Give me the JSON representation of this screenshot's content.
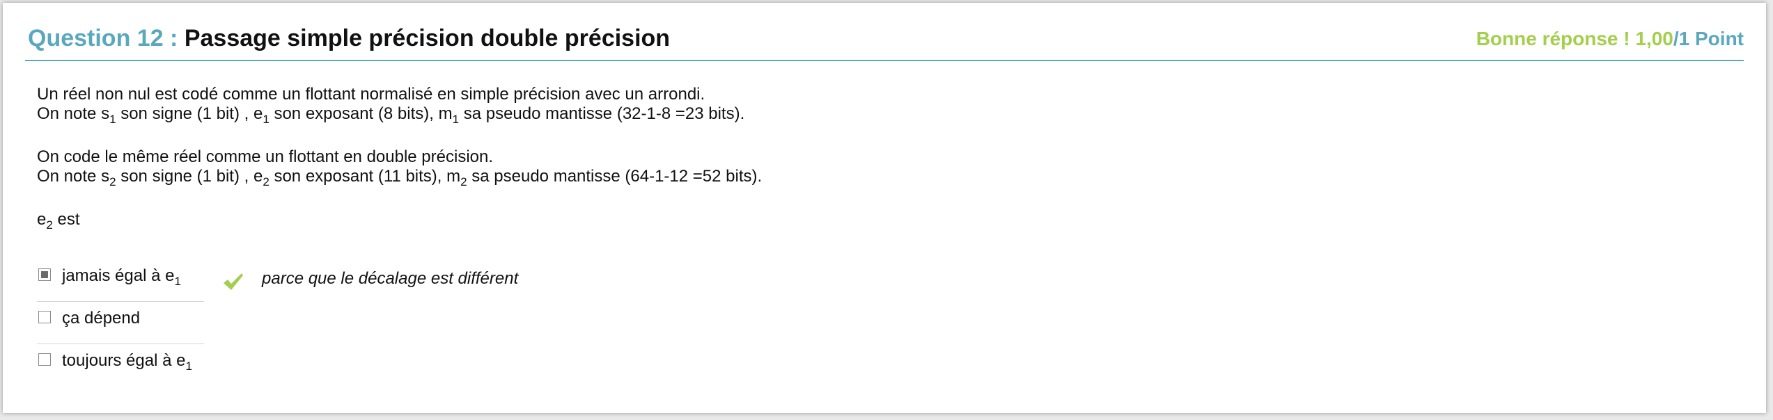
{
  "question": {
    "number_label": "Question 12 : ",
    "title": "Passage simple précision double précision",
    "score_text": "Bonne réponse ! 1,00",
    "score_points": "/1 Point"
  },
  "body": {
    "line1": "Un réel non nul est codé comme un flottant  normalisé en simple précision avec un arrondi.",
    "line2": {
      "a": "On note s",
      "sub_a": "1",
      "b": " son signe (1 bit) , e",
      "sub_b": "1",
      "c": " son exposant (8 bits), m",
      "sub_c": "1",
      "d": " sa pseudo mantisse (32-1-8 =23 bits)."
    },
    "line3": "On code le même réel comme un flottant en double précision.",
    "line4": {
      "a": "On note s",
      "sub_a": "2",
      "b": " son signe (1 bit) , e",
      "sub_b": "2",
      "c": " son exposant (11 bits), m",
      "sub_c": "2",
      "d": " sa pseudo mantisse (64-1-12 =52 bits)."
    },
    "prompt": {
      "a": "e",
      "sub": "2",
      "b": " est"
    }
  },
  "answers": [
    {
      "text": "jamais égal à e",
      "sub": "1",
      "checked": true
    },
    {
      "text": "ça dépend",
      "sub": "",
      "checked": false
    },
    {
      "text": "toujours égal à e",
      "sub": "1",
      "checked": false
    }
  ],
  "feedback": "parce que le décalage est différent",
  "colors": {
    "accent": "#5aa8bd",
    "correct": "#a3cf4c"
  },
  "icons": {
    "correct": "checkmark-icon"
  }
}
